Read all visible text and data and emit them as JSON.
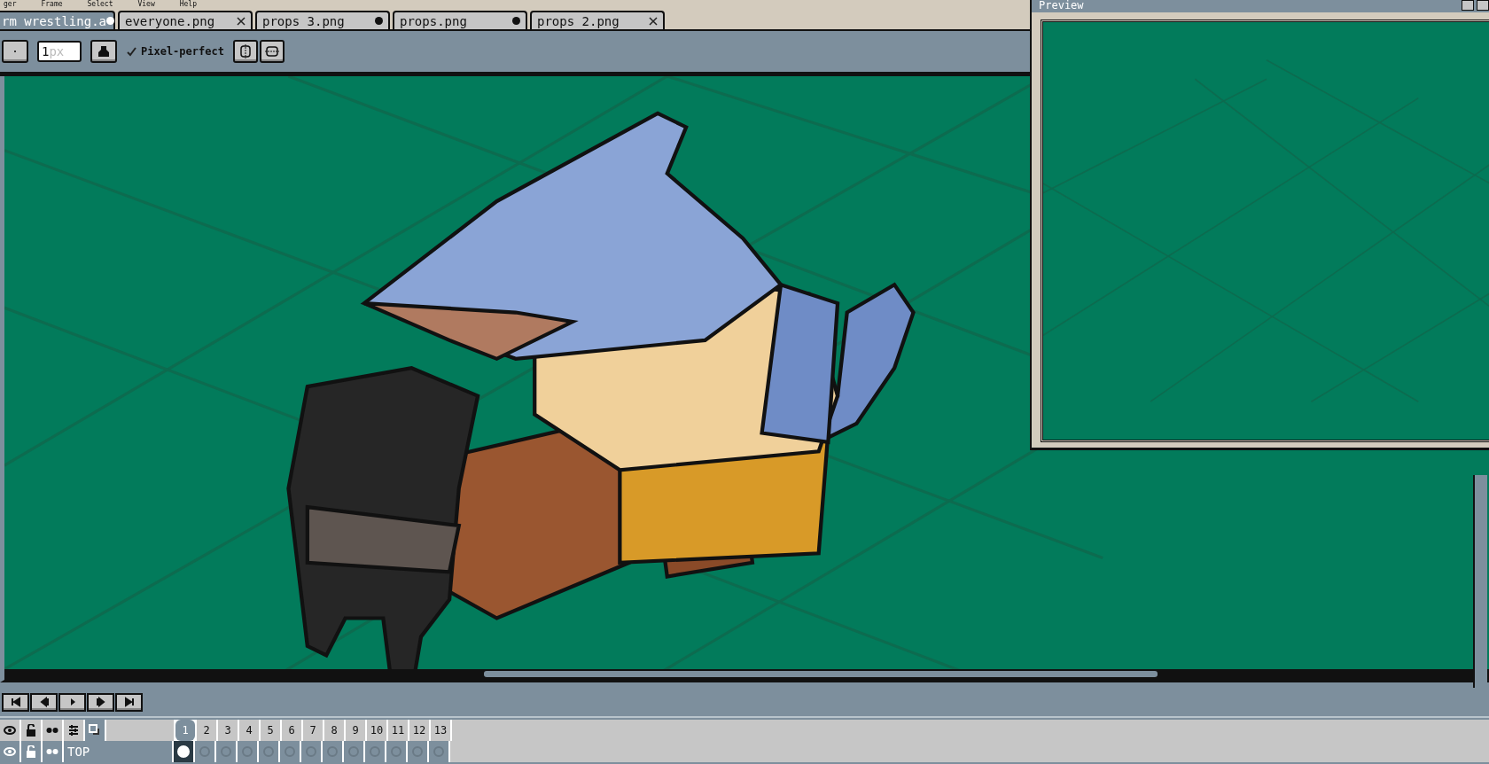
{
  "menu": [
    "ger",
    "Frame",
    "Select",
    "View",
    "Help"
  ],
  "tabs": [
    {
      "label": "rm wrestling.a",
      "selected": true,
      "modified": true
    },
    {
      "label": "everyone.png",
      "selected": false,
      "modified": false
    },
    {
      "label": "props 3.png",
      "selected": false,
      "modified": true
    },
    {
      "label": "props.png",
      "selected": false,
      "modified": true
    },
    {
      "label": "props 2.png",
      "selected": false,
      "modified": false
    }
  ],
  "toolbar": {
    "brush_size": {
      "value": "1",
      "unit": "px"
    },
    "pixel_perfect": {
      "label": "Pixel-perfect",
      "checked": true
    }
  },
  "preview": {
    "title": "Preview"
  },
  "timeline": {
    "frames": [
      {
        "label": "1",
        "selected": true
      },
      {
        "label": "2",
        "selected": false
      },
      {
        "label": "3",
        "selected": false
      },
      {
        "label": "4",
        "selected": false
      },
      {
        "label": "5",
        "selected": false
      },
      {
        "label": "6",
        "selected": false
      },
      {
        "label": "7",
        "selected": false
      },
      {
        "label": "8",
        "selected": false
      },
      {
        "label": "9",
        "selected": false
      },
      {
        "label": "10",
        "selected": false
      },
      {
        "label": "11",
        "selected": false
      },
      {
        "label": "12",
        "selected": false
      },
      {
        "label": "13",
        "selected": false
      }
    ],
    "layers": [
      {
        "name": "TOP",
        "cels": [
          {
            "kind": "filled"
          },
          {
            "kind": "empty"
          },
          {
            "kind": "empty"
          },
          {
            "kind": "empty"
          },
          {
            "kind": "empty"
          },
          {
            "kind": "empty"
          },
          {
            "kind": "empty"
          },
          {
            "kind": "empty"
          },
          {
            "kind": "empty"
          },
          {
            "kind": "empty"
          },
          {
            "kind": "empty"
          },
          {
            "kind": "empty"
          },
          {
            "kind": "empty"
          }
        ]
      }
    ]
  }
}
